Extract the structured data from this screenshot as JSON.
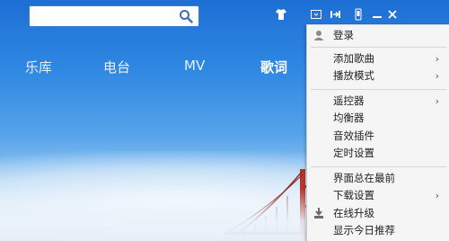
{
  "search": {
    "placeholder": "",
    "value": ""
  },
  "toolbar": {
    "icons": [
      "shirt-icon",
      "mini-mode-icon",
      "pin-icon",
      "phone-icon",
      "minimize-icon",
      "close-icon"
    ]
  },
  "tabs": [
    {
      "label": "乐库",
      "active": false
    },
    {
      "label": "电台",
      "active": false
    },
    {
      "label": "MV",
      "active": false
    },
    {
      "label": "歌词",
      "active": true
    }
  ],
  "menu": {
    "items": [
      {
        "label": "登录",
        "icon": "user-icon"
      },
      {
        "label": "添加歌曲",
        "submenu": true
      },
      {
        "label": "播放模式",
        "submenu": true
      },
      {
        "label": "遥控器",
        "submenu": true
      },
      {
        "label": "均衡器"
      },
      {
        "label": "音效插件"
      },
      {
        "label": "定时设置"
      },
      {
        "label": "界面总在最前"
      },
      {
        "label": "下载设置",
        "submenu": true
      },
      {
        "label": "在线升级",
        "icon": "download-icon"
      },
      {
        "label": "显示今日推荐"
      }
    ],
    "arrow": "›"
  },
  "colors": {
    "accent": "#2f87e3",
    "menu_bg": "#f5f5f5",
    "bridge": "#b7372e"
  }
}
